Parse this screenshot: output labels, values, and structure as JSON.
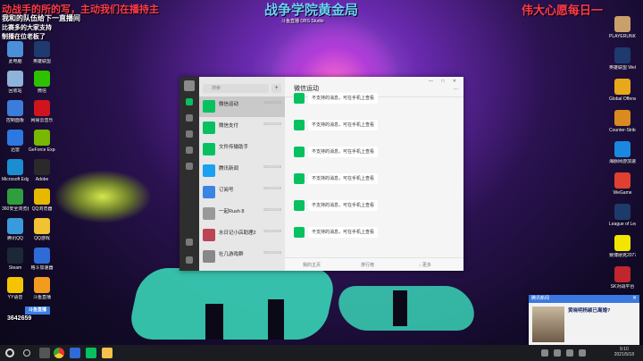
{
  "overlays": {
    "top_left_line1": "动战手的所的写，主动我们在播持主",
    "top_left_line2": "我和的队伍给下一直播间",
    "top_left_line3": "比赛多的大家支持",
    "top_left_line4": "制播在位老板了",
    "center_title": "战争学院黄金局",
    "center_sub": "斗鱼直播 OBS Studio",
    "top_right": "伟大心愿每日一",
    "counter": "3642659",
    "logo_text": "斗鱼直播"
  },
  "desktop_left": [
    {
      "label": "此电脑",
      "color": "#4a90d9"
    },
    {
      "label": "英雄联盟",
      "color": "#1f3a6e"
    },
    {
      "label": "回收站",
      "color": "#8fb3d9"
    },
    {
      "label": "微信",
      "color": "#2dc100"
    },
    {
      "label": "控制面板",
      "color": "#3b7dd8"
    },
    {
      "label": "网易云音乐",
      "color": "#d0141e"
    },
    {
      "label": "迅雷",
      "color": "#2b79e0"
    },
    {
      "label": "GeForce Experience",
      "color": "#76b900"
    },
    {
      "label": "Microsoft Edge",
      "color": "#1b8ed1"
    },
    {
      "label": "Adobe",
      "color": "#2a2a2a"
    },
    {
      "label": "360安全浏览器",
      "color": "#2e9e3e"
    },
    {
      "label": "QQ浏览器",
      "color": "#e6b800"
    },
    {
      "label": "腾讯QQ",
      "color": "#3a9bdc"
    },
    {
      "label": "QQ游戏",
      "color": "#f1c232"
    },
    {
      "label": "Steam",
      "color": "#1b2838"
    },
    {
      "label": "格斗加速器",
      "color": "#2e6bd6"
    },
    {
      "label": "YY语音",
      "color": "#f5c400"
    },
    {
      "label": "斗鱼直播",
      "color": "#f29b1f"
    }
  ],
  "desktop_right": [
    {
      "label": "PLAYERUNKNOWN'S BATTLEGROUNDS",
      "color": "#c9a06b"
    },
    {
      "label": "英雄联盟 WeGame版",
      "color": "#1f3a6e"
    },
    {
      "label": "Global Offensive",
      "color": "#e8a81a"
    },
    {
      "label": "Counter-Strike",
      "color": "#d98b1f"
    },
    {
      "label": "海豚网游加速器5.0",
      "color": "#1a88e0"
    },
    {
      "label": "WeGame",
      "color": "#e04030"
    },
    {
      "label": "League of Legends",
      "color": "#1c3b6a"
    },
    {
      "label": "赛博朋克2077",
      "color": "#f2e600"
    },
    {
      "label": "SK对战平台",
      "color": "#c0262d"
    }
  ],
  "wechat": {
    "search_placeholder": "搜索",
    "plus": "+",
    "chats": [
      {
        "name": "微信运动",
        "preview": "",
        "time": "2021/5/18",
        "color": "#07c160",
        "selected": true
      },
      {
        "name": "微信支付",
        "preview": "",
        "time": "2021/5/18",
        "color": "#07c160"
      },
      {
        "name": "文件传输助手",
        "preview": "",
        "time": "",
        "color": "#07c160"
      },
      {
        "name": "腾讯新闻",
        "preview": "",
        "time": "2021/5/18",
        "color": "#1aa1f0"
      },
      {
        "name": "订阅号",
        "preview": "",
        "time": "2021/5/18",
        "color": "#3b84e3"
      },
      {
        "name": "一起Rush 8",
        "preview": "",
        "time": "2021/5/18",
        "color": "#999999"
      },
      {
        "name": "水日记小店助理2",
        "preview": "",
        "time": "2021/5/18",
        "color": "#b45"
      },
      {
        "name": "社几游戏群",
        "preview": "",
        "time": "2021/5/18",
        "color": "#888"
      }
    ],
    "title": "微信运动",
    "more": "...",
    "win_controls": "—  □  ✕",
    "messages": [
      {
        "text": "不支持的消息，可在手机上查看",
        "stamp": ""
      },
      {
        "text": "不支持的消息，可在手机上查看",
        "stamp": ""
      },
      {
        "text": "不支持的消息，可在手机上查看",
        "stamp": ""
      },
      {
        "text": "不支持的消息，可在手机上查看",
        "stamp": ""
      },
      {
        "text": "不支持的消息，可在手机上查看",
        "stamp": ""
      },
      {
        "text": "不支持的消息，可在手机上查看",
        "stamp": ""
      }
    ],
    "footer": {
      "left": "我的主页",
      "mid": "排行榜",
      "right": "↓ 更多"
    }
  },
  "notification": {
    "header": "腾讯新闻",
    "close": "✕",
    "title": "黄晓明杨颖已离婚?",
    "body": ""
  },
  "taskbar": {
    "time": "9:10",
    "date": "2021/5/18"
  }
}
